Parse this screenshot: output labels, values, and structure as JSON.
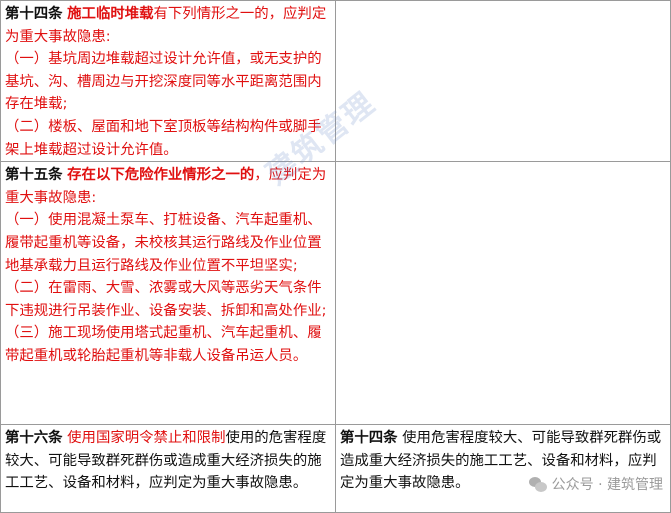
{
  "rows": [
    {
      "left": {
        "article": "第十四条",
        "heading": "施工临时堆载",
        "rest": "有下列情形之一的，应判定为重大事故隐患:",
        "items": [
          "（一）基坑周边堆载超过设计允许值，或无支护的基坑、沟、槽周边与开挖深度同等水平距离范围内存在堆载;",
          "（二）楼板、屋面和地下室顶板等结构构件或脚手架上堆载超过设计允许值。"
        ]
      },
      "right": ""
    },
    {
      "left": {
        "article": "第十五条",
        "heading": "存在以下危险作业情形之一的",
        "rest": "，应判定为重大事故隐患:",
        "items": [
          "（一）使用混凝土泵车、打桩设备、汽车起重机、履带起重机等设备，未校核其运行路线及作业位置地基承载力且运行路线及作业位置不平坦坚实;",
          "（二）在雷雨、大雪、浓雾或大风等恶劣天气条件下违规进行吊装作业、设备安装、拆卸和高处作业;",
          "（三）施工现场使用塔式起重机、汽车起重机、履带起重机或轮胎起重机等非载人设备吊运人员。"
        ]
      },
      "right": ""
    },
    {
      "left": {
        "article": "第十六条",
        "highlight": "使用国家明令禁止和限制",
        "rest": "使用的危害程度较大、可能导致群死群伤或造成重大经济损失的施工工艺、设备和材料，应判定为重大事故隐患。"
      },
      "right": {
        "article": "第十四条",
        "rest": "使用危害程度较大、可能导致群死群伤或造成重大经济损失的施工工艺、设备和材料，应判定为重大事故隐患。"
      }
    }
  ],
  "watermark": "建筑管理",
  "footer": {
    "label": "公众号 · 建筑管理",
    "icon": "wechat-icon"
  },
  "colors": {
    "new_text": "#e01010",
    "old_text": "#111111",
    "border": "#9a9a9a"
  }
}
